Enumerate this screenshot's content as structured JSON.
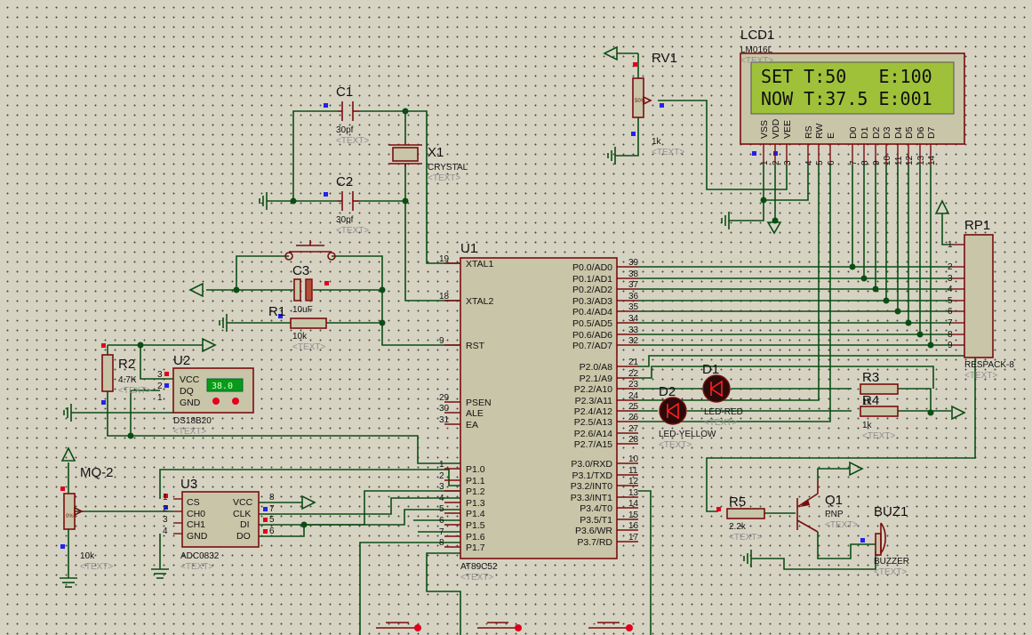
{
  "lcd": {
    "ref": "LCD1",
    "part": "LM016L",
    "text_tag": "<TEXT>",
    "line1": "SET T:50   E:100",
    "line2": "NOW T:37.5 E:001",
    "pins": [
      "VSS",
      "VDD",
      "VEE",
      "RS",
      "RW",
      "E",
      "D0",
      "D1",
      "D2",
      "D3",
      "D4",
      "D5",
      "D6",
      "D7"
    ],
    "pin_numbers": [
      "1",
      "2",
      "3",
      "4",
      "5",
      "6",
      "7",
      "8",
      "9",
      "10",
      "11",
      "12",
      "13",
      "14"
    ]
  },
  "rv1": {
    "ref": "RV1",
    "value": "1k",
    "text_tag": "<TEXT>",
    "wiper": "50%"
  },
  "c1": {
    "ref": "C1",
    "value": "30pf",
    "text_tag": "<TEXT>"
  },
  "c2": {
    "ref": "C2",
    "value": "30pf",
    "text_tag": "<TEXT>"
  },
  "x1": {
    "ref": "X1",
    "value": "CRYSTAL",
    "text_tag": "<TEXT>"
  },
  "c3": {
    "ref": "C3",
    "value": "10uF",
    "text_tag": "<TEXT>"
  },
  "r1": {
    "ref": "R1",
    "value": "10k",
    "text_tag": "<TEXT>"
  },
  "r2": {
    "ref": "R2",
    "value": "4.7K",
    "text_tag": "<TEXT>"
  },
  "u2": {
    "ref": "U2",
    "part": "DS18B20",
    "text_tag": "<TEXT>",
    "reading": "38.0",
    "pins": [
      "VCC",
      "DQ",
      "GND"
    ],
    "pin_numbers": [
      "3",
      "2",
      "1"
    ]
  },
  "mq2": {
    "ref": "MQ-2",
    "value": "10k",
    "text_tag": "<TEXT>",
    "wiper": "0%"
  },
  "u3": {
    "ref": "U3",
    "part": "ADC0832",
    "text_tag": "<TEXT>",
    "left_pins": [
      "CS",
      "CH0",
      "CH1",
      "GND"
    ],
    "left_numbers": [
      "1",
      "2",
      "3",
      "4"
    ],
    "right_pins": [
      "VCC",
      "CLK",
      "DI",
      "DO"
    ],
    "right_numbers": [
      "8",
      "7",
      "5",
      "6"
    ]
  },
  "u1": {
    "ref": "U1",
    "part": "AT89C52",
    "text_tag": "<TEXT>",
    "left_pins": [
      "XTAL1",
      "XTAL2",
      "RST",
      "PSEN",
      "ALE",
      "EA",
      "P1.0",
      "P1.1",
      "P1.2",
      "P1.3",
      "P1.4",
      "P1.5",
      "P1.6",
      "P1.7"
    ],
    "left_numbers": [
      "19",
      "18",
      "9",
      "29",
      "30",
      "31",
      "1",
      "2",
      "3",
      "4",
      "5",
      "6",
      "7",
      "8"
    ],
    "right_pins": [
      "P0.0/AD0",
      "P0.1/AD1",
      "P0.2/AD2",
      "P0.3/AD3",
      "P0.4/AD4",
      "P0.5/AD5",
      "P0.6/AD6",
      "P0.7/AD7",
      "P2.0/A8",
      "P2.1/A9",
      "P2.2/A10",
      "P2.3/A11",
      "P2.4/A12",
      "P2.5/A13",
      "P2.6/A14",
      "P2.7/A15",
      "P3.0/RXD",
      "P3.1/TXD",
      "P3.2/INT0",
      "P3.3/INT1",
      "P3.4/T0",
      "P3.5/T1",
      "P3.6/WR",
      "P3.7/RD"
    ],
    "right_numbers": [
      "39",
      "38",
      "37",
      "36",
      "35",
      "34",
      "33",
      "32",
      "21",
      "22",
      "23",
      "24",
      "25",
      "26",
      "27",
      "28",
      "10",
      "11",
      "12",
      "13",
      "14",
      "15",
      "16",
      "17"
    ]
  },
  "rp1": {
    "ref": "RP1",
    "part": "RESPACK-8",
    "text_tag": "<TEXT>",
    "pin_numbers": [
      "1",
      "2",
      "3",
      "4",
      "5",
      "6",
      "7",
      "8",
      "9"
    ]
  },
  "d1": {
    "ref": "D1",
    "value": "LED-RED",
    "text_tag": "<TEXT>"
  },
  "d2": {
    "ref": "D2",
    "value": "LED-YELLOW",
    "text_tag": "<TEXT>"
  },
  "r3": {
    "ref": "R3",
    "value": "1k",
    "text_tag": "<TEXT>"
  },
  "r4": {
    "ref": "R4",
    "value": "1k",
    "text_tag": "<TEXT>"
  },
  "r5": {
    "ref": "R5",
    "value": "2.2k",
    "text_tag": "<TEXT>"
  },
  "q1": {
    "ref": "Q1",
    "value": "PNP",
    "text_tag": "<TEXT>"
  },
  "buz1": {
    "ref": "BUZ1",
    "value": "BUZZER",
    "text_tag": "<TEXT>"
  }
}
